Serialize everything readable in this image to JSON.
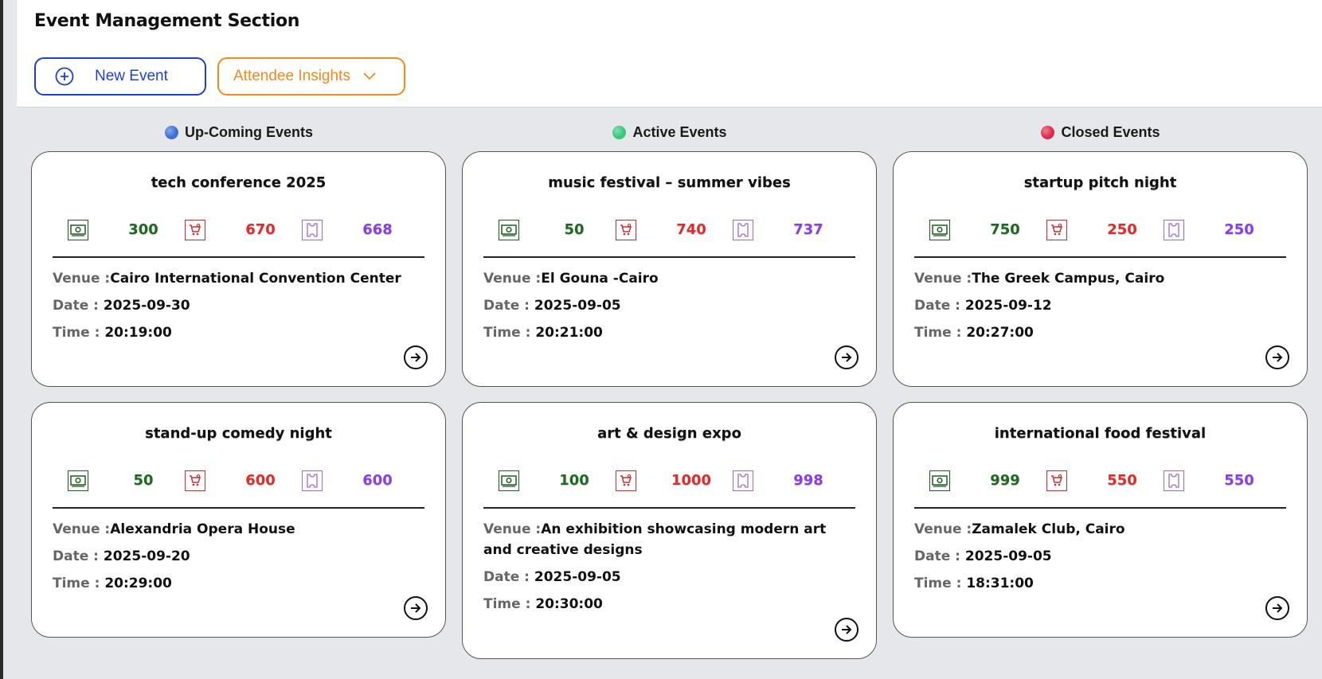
{
  "header": {
    "title": "Event Management Section",
    "new_event_label": "New Event",
    "insights_label": "Attendee Insights"
  },
  "columns": [
    {
      "label": "Up-Coming Events",
      "dot_color": "#3b6fd6"
    },
    {
      "label": "Active Events",
      "dot_color": "#34c97a"
    },
    {
      "label": "Closed Events",
      "dot_color": "#e0294a"
    }
  ],
  "labels": {
    "venue": "Venue :",
    "date": "Date : ",
    "time": "Time : "
  },
  "colors": {
    "sold": "#1d6a1e",
    "capacity": "#e02b2b",
    "remaining": "#8a3ee6",
    "primary": "#1f3fd1",
    "accent": "#f08a1c"
  },
  "events": [
    {
      "title": "tech conference 2025",
      "sold": "300",
      "capacity": "670",
      "remaining": "668",
      "venue": "Cairo International Convention Center",
      "date": "2025-09-30",
      "time": "20:19:00"
    },
    {
      "title": "music festival – summer vibes",
      "sold": "50",
      "capacity": "740",
      "remaining": "737",
      "venue": "El Gouna -Cairo",
      "date": "2025-09-05",
      "time": "20:21:00"
    },
    {
      "title": "startup pitch night",
      "sold": "750",
      "capacity": "250",
      "remaining": "250",
      "venue": "The Greek Campus, Cairo",
      "date": "2025-09-12",
      "time": "20:27:00"
    },
    {
      "title": "stand-up comedy night",
      "sold": "50",
      "capacity": "600",
      "remaining": "600",
      "venue": "Alexandria Opera House",
      "date": "2025-09-20",
      "time": "20:29:00"
    },
    {
      "title": "art & design expo",
      "sold": "100",
      "capacity": "1000",
      "remaining": "998",
      "venue": "An exhibition showcasing modern art and creative designs",
      "date": "2025-09-05",
      "time": "20:30:00"
    },
    {
      "title": "international food festival",
      "sold": "999",
      "capacity": "550",
      "remaining": "550",
      "venue": "Zamalek Club, Cairo",
      "date": "2025-09-05",
      "time": "18:31:00"
    }
  ]
}
